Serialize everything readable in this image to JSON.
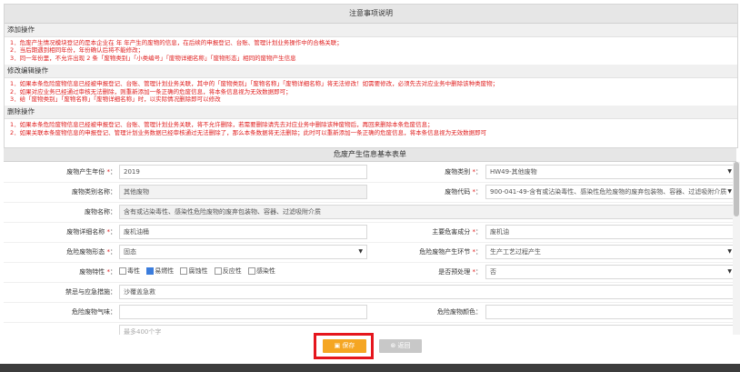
{
  "notice": {
    "title": "注意事项说明",
    "add": {
      "heading": "添加操作",
      "lines": [
        "1．危废产生情况模块登记的是本企业在 年 年产生的废物的信息，在后续的申报登记、台账、管理计划业务操作中的合格关联；",
        "2．当后期遇到相同年份，年份确认后将不能修改；",
        "3．同一年份里，不允许出现 2 条「废物类别」「小类编号」「废物详细名称」「废物形态」相同的废物产生信息"
      ]
    },
    "edit": {
      "heading": "修改编辑操作",
      "lines": [
        "1．如果本条危险废物信息已经被申报登记、台账、管理计划业务关联，其中的「废物类别」「废物名称」「废物详细名称」将无法修改！如需要修改，必须先去对应业务中删除该种类废物；",
        "2．如果对应业务已经通过审核无法删除，则重新添加一条正确的危废信息，将本条信息视为无效数据即可；",
        "3．给「废物类别」「废物名称」「废物详细名称」时，以实际情况删除即可以修改"
      ]
    },
    "del": {
      "heading": "删除操作",
      "lines": [
        "1．如果本条危险废物信息已经被申报登记、台账、管理计划业务关联，将不允许删除，若需要删除请先去对应业务中删除该种废物后，再回来删除本条危废信息；",
        "2．如果关联本条废物信息的申报登记、管理计划业务数据已经审核通过无法删除了，那么本条数据将无法删除；此时可以重新添加一条正确的危废信息，将本条信息视为无效数据即可"
      ]
    }
  },
  "form": {
    "title": "危废产生信息基本表单",
    "year": {
      "label": "废物产生年份",
      "value": "2019"
    },
    "category": {
      "label": "废物类别",
      "value": "HW49-其他废物"
    },
    "category_name": {
      "label": "废物类别名称",
      "value": "其他废物"
    },
    "code": {
      "label": "废物代码",
      "value": "900-041-49-含有或沾染毒性、感染性危险废物的废弃包装物、容器、过滤吸附介质"
    },
    "waste_name": {
      "label": "废物名称",
      "value": "含有或沾染毒性、感染性危险废物的废弃包装物、容器、过滤吸附介质"
    },
    "detail_name": {
      "label": "废物详细名称",
      "value": "废机油桶"
    },
    "main_component": {
      "label": "主要危害成分",
      "value": "废机油"
    },
    "form_state": {
      "label": "危险废物形态",
      "value": "固态"
    },
    "stage": {
      "label": "危险废物产生环节",
      "value": "生产工艺过程产生"
    },
    "property": {
      "label": "废物特性",
      "options": [
        {
          "label": "毒性",
          "checked": false
        },
        {
          "label": "易燃性",
          "checked": true
        },
        {
          "label": "腐蚀性",
          "checked": false
        },
        {
          "label": "反应性",
          "checked": false
        },
        {
          "label": "感染性",
          "checked": false
        }
      ]
    },
    "pretreat": {
      "label": "是否预处理",
      "value": "否"
    },
    "prevention": {
      "label": "禁忌与应急措施",
      "value": "沙覆盖急救"
    },
    "smell": {
      "label": "危险废物气味",
      "value": ""
    },
    "color": {
      "label": "危险废物颜色",
      "value": ""
    },
    "remark": {
      "placeholder": "最多400个字"
    }
  },
  "buttons": {
    "save": "保存",
    "cancel": "返回"
  },
  "icons": {
    "save": "floppy-icon",
    "cancel": "close-circle-icon"
  },
  "colors": {
    "required": "#e02020",
    "save_button": "#f5a623",
    "highlight_box": "#e5161d",
    "notice_text": "#e02020"
  }
}
